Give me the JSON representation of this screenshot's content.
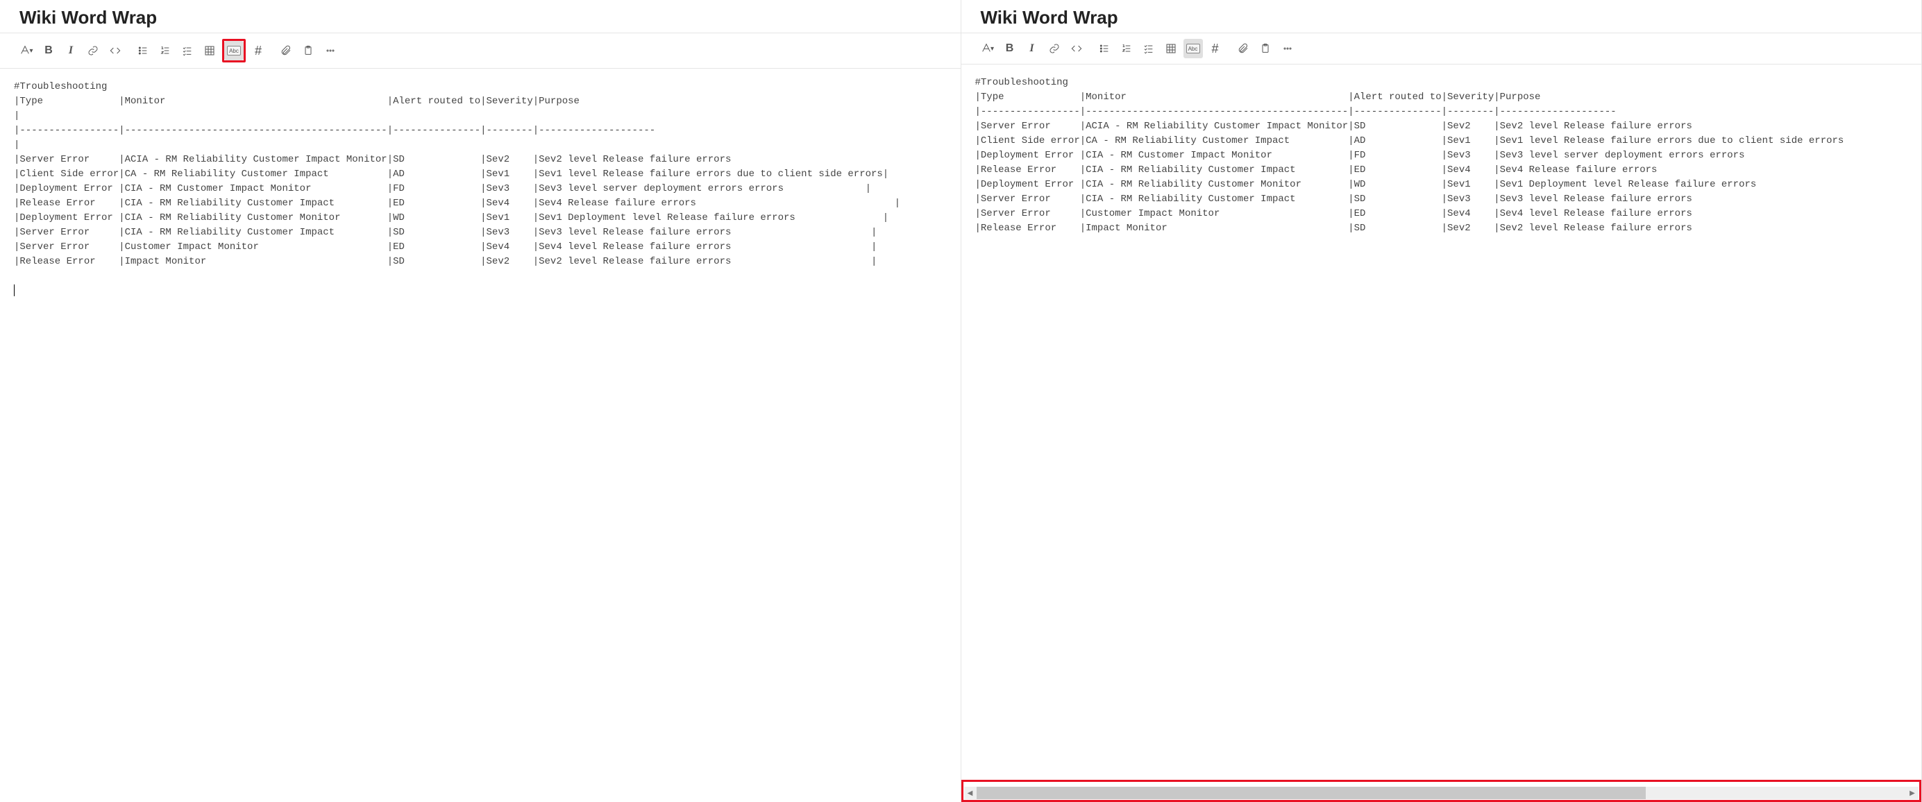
{
  "title": "Wiki Word Wrap",
  "toolbar": {
    "abc_label": "Abc",
    "hash_label": "#",
    "bold_label": "B",
    "italic_label": "I"
  },
  "left": {
    "text": "#Troubleshooting\n|Type             |Monitor                                      |Alert routed to|Severity|Purpose\n|\n|-----------------|---------------------------------------------|---------------|--------|--------------------\n|\n|Server Error     |ACIA - RM Reliability Customer Impact Monitor|SD             |Sev2    |Sev2 level Release failure errors\n|Client Side error|CA - RM Reliability Customer Impact          |AD             |Sev1    |Sev1 level Release failure errors due to client side errors|\n|Deployment Error |CIA - RM Customer Impact Monitor             |FD             |Sev3    |Sev3 level server deployment errors errors              |\n|Release Error    |CIA - RM Reliability Customer Impact         |ED             |Sev4    |Sev4 Release failure errors                                  |\n|Deployment Error |CIA - RM Reliability Customer Monitor        |WD             |Sev1    |Sev1 Deployment level Release failure errors               |\n|Server Error     |CIA - RM Reliability Customer Impact         |SD             |Sev3    |Sev3 level Release failure errors                        |\n|Server Error     |Customer Impact Monitor                      |ED             |Sev4    |Sev4 level Release failure errors                        |\n|Release Error    |Impact Monitor                               |SD             |Sev2    |Sev2 level Release failure errors                        |\n\n"
  },
  "right": {
    "text": "#Troubleshooting\n|Type             |Monitor                                      |Alert routed to|Severity|Purpose\n|-----------------|---------------------------------------------|---------------|--------|--------------------\n|Server Error     |ACIA - RM Reliability Customer Impact Monitor|SD             |Sev2    |Sev2 level Release failure errors\n|Client Side error|CA - RM Reliability Customer Impact          |AD             |Sev1    |Sev1 level Release failure errors due to client side errors\n|Deployment Error |CIA - RM Customer Impact Monitor             |FD             |Sev3    |Sev3 level server deployment errors errors\n|Release Error    |CIA - RM Reliability Customer Impact         |ED             |Sev4    |Sev4 Release failure errors\n|Deployment Error |CIA - RM Reliability Customer Monitor        |WD             |Sev1    |Sev1 Deployment level Release failure errors\n|Server Error     |CIA - RM Reliability Customer Impact         |SD             |Sev3    |Sev3 level Release failure errors\n|Server Error     |Customer Impact Monitor                      |ED             |Sev4    |Sev4 level Release failure errors\n|Release Error    |Impact Monitor                               |SD             |Sev2    |Sev2 level Release failure errors"
  }
}
